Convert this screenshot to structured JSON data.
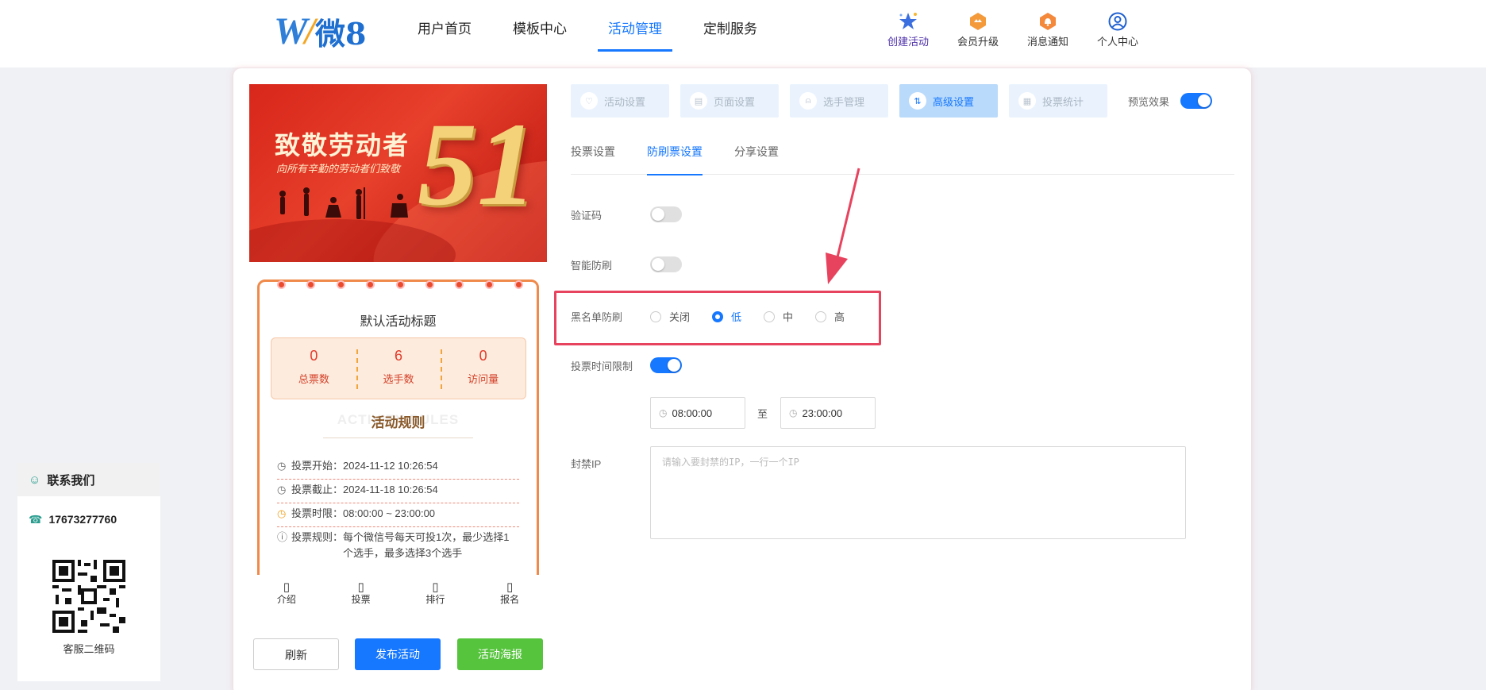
{
  "header": {
    "logo_text": "微8",
    "nav": [
      {
        "label": "用户首页",
        "active": false
      },
      {
        "label": "模板中心",
        "active": false
      },
      {
        "label": "活动管理",
        "active": true
      },
      {
        "label": "定制服务",
        "active": false
      }
    ],
    "tools": [
      {
        "label": "创建活动",
        "icon": "star-icon"
      },
      {
        "label": "会员升级",
        "icon": "vip-badge-icon"
      },
      {
        "label": "消息通知",
        "icon": "bell-badge-icon"
      },
      {
        "label": "个人中心",
        "icon": "user-circle-icon"
      }
    ]
  },
  "preview": {
    "banner_title": "致敬劳动者",
    "banner_subtitle": "向所有辛勤的劳动者们致敬",
    "banner_number": "51",
    "activity_title": "默认活动标题",
    "stats": [
      {
        "value": "0",
        "label": "总票数"
      },
      {
        "value": "6",
        "label": "选手数"
      },
      {
        "value": "0",
        "label": "访问量"
      }
    ],
    "rules_watermark": "ACTIVITY RULES",
    "rules_title": "活动规则",
    "rules": [
      {
        "title": "投票开始：",
        "value": "2024-11-12 10:26:54"
      },
      {
        "title": "投票截止：",
        "value": "2024-11-18 10:26:54"
      },
      {
        "title": "投票时限：",
        "value": "08:00:00 ~ 23:00:00"
      },
      {
        "title": "投票规则：",
        "value": "每个微信号每天可投1次，最少选择1个选手，最多选择3个选手"
      }
    ],
    "tabbar": [
      "介绍",
      "投票",
      "排行",
      "报名"
    ]
  },
  "buttons": {
    "refresh": "刷新",
    "publish": "发布活动",
    "poster": "活动海报"
  },
  "steps": [
    {
      "label": "活动设置",
      "icon": "heart-icon",
      "active": false
    },
    {
      "label": "页面设置",
      "icon": "page-icon",
      "active": false
    },
    {
      "label": "选手管理",
      "icon": "person-icon",
      "active": false
    },
    {
      "label": "高级设置",
      "icon": "sliders-icon",
      "active": true
    },
    {
      "label": "投票统计",
      "icon": "stats-icon",
      "active": false
    }
  ],
  "preview_toggle": {
    "label": "预览效果",
    "on": true
  },
  "subtabs": [
    {
      "label": "投票设置",
      "active": false
    },
    {
      "label": "防刷票设置",
      "active": true
    },
    {
      "label": "分享设置",
      "active": false
    }
  ],
  "settings": {
    "captcha": {
      "label": "验证码",
      "on": false
    },
    "smart_guard": {
      "label": "智能防刷",
      "on": false
    },
    "blacklist": {
      "label": "黑名单防刷",
      "options": [
        "关闭",
        "低",
        "中",
        "高"
      ],
      "selected": "低"
    },
    "time_limit": {
      "label": "投票时间限制",
      "on": true,
      "start": "08:00:00",
      "end": "23:00:00",
      "separator": "至"
    },
    "ban_ip": {
      "label": "封禁IP",
      "placeholder": "请输入要封禁的IP，一行一个IP",
      "value": ""
    }
  },
  "contact": {
    "title": "联系我们",
    "phone": "17673277760",
    "qr_label": "客服二维码"
  },
  "colors": {
    "primary": "#1677ff",
    "highlight": "#e8435e",
    "publish": "#1677ff",
    "poster": "#56c43d"
  }
}
